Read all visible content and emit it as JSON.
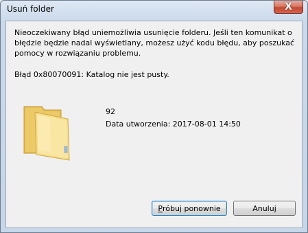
{
  "window": {
    "title": "Usuń folder",
    "close_glyph": "X"
  },
  "message": {
    "text": "Nieoczekiwany błąd uniemożliwia usunięcie folderu. Jeśli ten komunikat o błędzie będzie nadal wyświetlany, możesz użyć kodu błędu, aby poszukać pomocy w rozwiązaniu problemu.",
    "error": "Błąd 0x80070091: Katalog nie jest pusty."
  },
  "item": {
    "icon": "folder-icon",
    "name": "92",
    "date": "Data utworzenia: 2017-08-01 14:50"
  },
  "buttons": {
    "retry_first_letter": "P",
    "retry_rest": "róbuj ponownie",
    "cancel": "Anuluj"
  },
  "colors": {
    "title_bar": "#cbd9ea",
    "client_bg": "#f0f0f0",
    "close_button": "#c9503a",
    "folder": "#f2d67a"
  }
}
